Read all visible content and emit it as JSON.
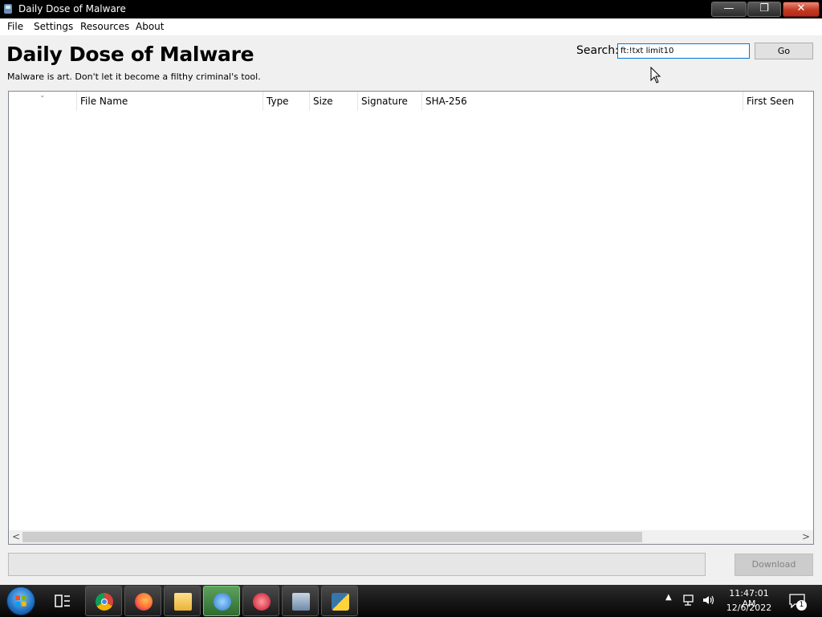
{
  "window": {
    "title": "Daily Dose of Malware",
    "icon": "malware-app-icon",
    "controls": {
      "minimize": "minimize-icon",
      "maximize": "restore-icon",
      "close": "close-icon"
    }
  },
  "menu": {
    "items": [
      "File",
      "Settings",
      "Resources",
      "About"
    ]
  },
  "header": {
    "title": "Daily Dose of Malware",
    "subtitle": "Malware is art. Don't let it become a filthy criminal's tool."
  },
  "search": {
    "label": "Search:",
    "value": "ft:!txt limit10",
    "button": "Go"
  },
  "table": {
    "sort_indicator": "⌄",
    "columns": [
      "",
      "File Name",
      "Type",
      "Size",
      "Signature",
      "SHA-256",
      "First Seen"
    ],
    "rows": [],
    "scroll_left": "<",
    "scroll_right": ">",
    "scroll_fraction": 0.78
  },
  "footer": {
    "status_text": "",
    "download_label": "Download"
  },
  "taskbar": {
    "apps": [
      "chrome-icon",
      "firefox-icon",
      "file-explorer-icon",
      "app-icon",
      "app-icon",
      "app-icon",
      "python-icon"
    ],
    "tray_arrow": "▲",
    "time": "11:47:01 AM",
    "date": "12/6/2022",
    "notifications": "1"
  },
  "colors": {
    "title_bar": "#000000",
    "close_button": "#c23b21",
    "search_border": "#0078d7",
    "taskbar_active": "#3f8a3f"
  }
}
